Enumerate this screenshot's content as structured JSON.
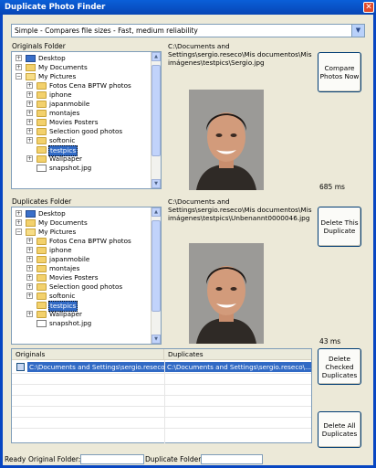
{
  "window": {
    "title": "Duplicate Photo Finder",
    "close_glyph": "✕"
  },
  "mode_select": {
    "value": "Simple - Compares file sizes - Fast, medium reliability",
    "arrow": "▼"
  },
  "originals": {
    "label": "Originals Folder",
    "tree": [
      {
        "expander": "+",
        "icon": "desktop",
        "label": "Desktop",
        "level": 0
      },
      {
        "expander": "+",
        "icon": "docs",
        "label": "My Documents",
        "level": 0
      },
      {
        "expander": "−",
        "icon": "folder-open",
        "label": "My Pictures",
        "level": 0
      },
      {
        "expander": "+",
        "icon": "folder",
        "label": "Fotos Cena BPTW photos",
        "level": 1
      },
      {
        "expander": "+",
        "icon": "folder",
        "label": "iphone",
        "level": 1
      },
      {
        "expander": "+",
        "icon": "folder",
        "label": "japanmobile",
        "level": 1
      },
      {
        "expander": "+",
        "icon": "folder",
        "label": "montajes",
        "level": 1
      },
      {
        "expander": "+",
        "icon": "folder",
        "label": "Movies Posters",
        "level": 1
      },
      {
        "expander": "+",
        "icon": "folder",
        "label": "Selection good photos",
        "level": 1
      },
      {
        "expander": "+",
        "icon": "folder",
        "label": "softonic",
        "level": 1
      },
      {
        "expander": "",
        "icon": "folder",
        "label": "testpics",
        "level": 1,
        "selected": true
      },
      {
        "expander": "+",
        "icon": "folder",
        "label": "Wallpaper",
        "level": 1
      },
      {
        "expander": "",
        "icon": "file",
        "label": "snapshot.jpg",
        "level": 1
      }
    ],
    "path": "C:\\Documents and Settings\\sergio.reseco\\Mis documentos\\Mis imágenes\\testpics\\Sergio.jpg",
    "time": "685  ms"
  },
  "duplicates": {
    "label": "Duplicates Folder",
    "tree": [
      {
        "expander": "+",
        "icon": "desktop",
        "label": "Desktop",
        "level": 0
      },
      {
        "expander": "+",
        "icon": "docs",
        "label": "My Documents",
        "level": 0
      },
      {
        "expander": "−",
        "icon": "folder-open",
        "label": "My Pictures",
        "level": 0
      },
      {
        "expander": "+",
        "icon": "folder",
        "label": "Fotos Cena BPTW photos",
        "level": 1
      },
      {
        "expander": "+",
        "icon": "folder",
        "label": "iphone",
        "level": 1
      },
      {
        "expander": "+",
        "icon": "folder",
        "label": "japanmobile",
        "level": 1
      },
      {
        "expander": "+",
        "icon": "folder",
        "label": "montajes",
        "level": 1
      },
      {
        "expander": "+",
        "icon": "folder",
        "label": "Movies Posters",
        "level": 1
      },
      {
        "expander": "+",
        "icon": "folder",
        "label": "Selection good photos",
        "level": 1
      },
      {
        "expander": "+",
        "icon": "folder",
        "label": "softonic",
        "level": 1
      },
      {
        "expander": "",
        "icon": "folder",
        "label": "testpics",
        "level": 1,
        "selected": true
      },
      {
        "expander": "+",
        "icon": "folder",
        "label": "Wallpaper",
        "level": 1
      },
      {
        "expander": "",
        "icon": "file",
        "label": "snapshot.jpg",
        "level": 1
      }
    ],
    "path": "C:\\Documents and Settings\\sergio.reseco\\Mis documentos\\Mis imágenes\\testpics\\Unbenannt0000046.jpg",
    "time": "43  ms"
  },
  "buttons": {
    "compare": "Compare Photos Now",
    "delete_this": "Delete This Duplicate",
    "delete_checked": "Delete Checked Duplicates",
    "delete_all": "Delete All Duplicates"
  },
  "results": {
    "columns": [
      "Originals",
      "Duplicates"
    ],
    "rows": [
      {
        "checked": false,
        "original": "C:\\Documents and Settings\\sergio.reseco\\...",
        "duplicate": "C:\\Documents and Settings\\sergio.reseco\\..."
      }
    ]
  },
  "status": {
    "state": "Ready",
    "original_label": "Original Folder:",
    "duplicate_label": "Duplicate Folder:"
  },
  "colors": {
    "title_bar": "#0a5fd8",
    "selection": "#316ac5",
    "window_bg": "#ece9d8"
  }
}
